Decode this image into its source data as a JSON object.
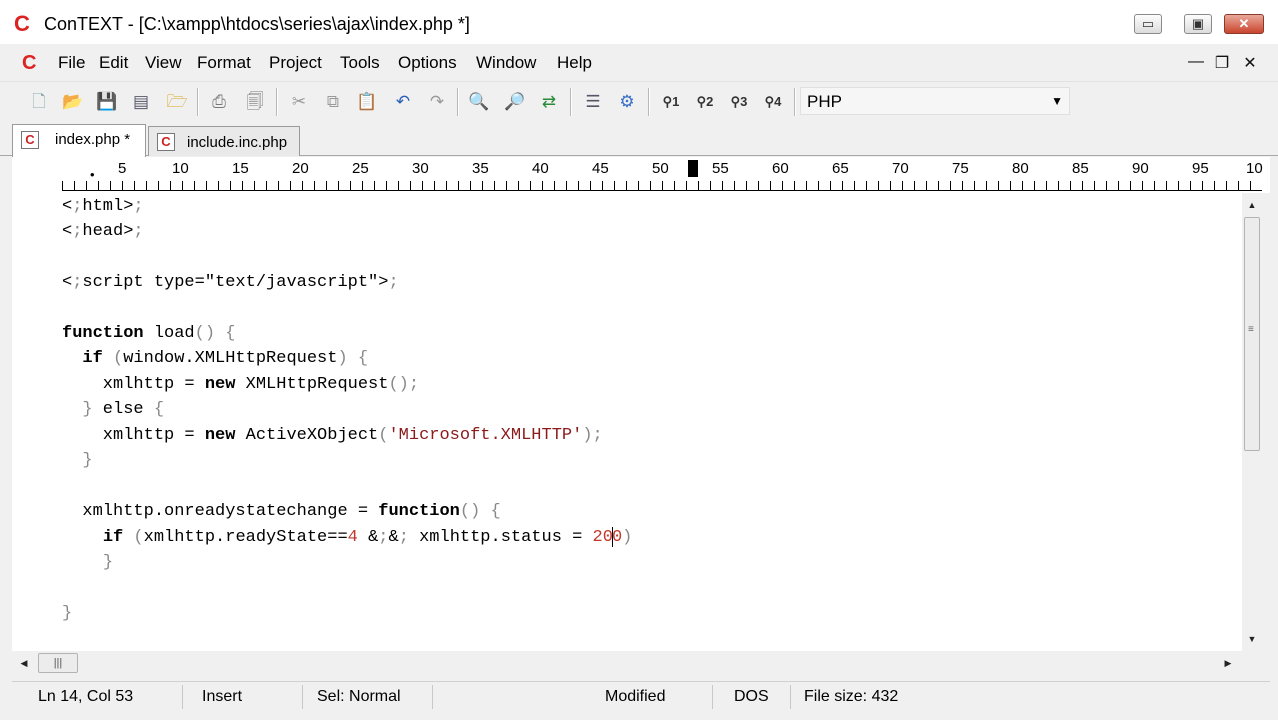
{
  "window": {
    "title": "ConTEXT - [C:\\xampp\\htdocs\\series\\ajax\\index.php *]",
    "logo": "C",
    "buttons": {
      "minimize": "▭",
      "maximize": "▣",
      "close": "✕"
    }
  },
  "menu": {
    "logo": "C",
    "items": [
      "File",
      "Edit",
      "View",
      "Format",
      "Project",
      "Tools",
      "Options",
      "Window",
      "Help"
    ],
    "mdi_buttons": {
      "minimize": "—",
      "restore": "❐",
      "close": "✕"
    }
  },
  "toolbar": {
    "highlighters": [
      "1",
      "2",
      "3",
      "4"
    ],
    "language": "PHP"
  },
  "tabs": [
    {
      "label": "index.php *",
      "active": true
    },
    {
      "label": "include.inc.php",
      "active": false
    }
  ],
  "ruler": {
    "numbers": [
      "5",
      "10",
      "15",
      "20",
      "25",
      "30",
      "35",
      "40",
      "45",
      "50",
      "55",
      "60",
      "65",
      "70",
      "75",
      "80",
      "85",
      "90",
      "95",
      "10"
    ]
  },
  "code": {
    "lines": [
      "<html>",
      "<head>",
      "",
      "<script type=\"text/javascript\">",
      "",
      "function load() {",
      "  if (window.XMLHttpRequest) {",
      "    xmlhttp = new XMLHttpRequest();",
      "  } else {",
      "    xmlhttp = new ActiveXObject('Microsoft.XMLHTTP');",
      "  }",
      "",
      "  xmlhttp.onreadystatechange = function() {",
      "    if (xmlhttp.readyState==4 && xmlhttp.status = 200)",
      "    }",
      "",
      "}"
    ]
  },
  "status": {
    "position": "Ln 14, Col 53",
    "mode": "Insert",
    "selection": "Sel: Normal",
    "modified": "Modified",
    "line_endings": "DOS",
    "file_size": "File size: 432"
  }
}
